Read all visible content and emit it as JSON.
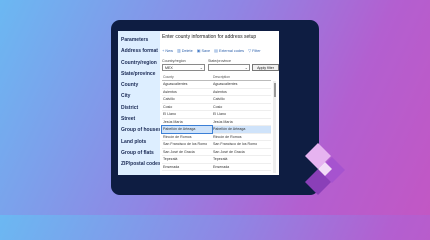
{
  "sidebar": {
    "items": [
      {
        "label": "Parameters"
      },
      {
        "label": "Address format"
      },
      {
        "label": "Country/region"
      },
      {
        "label": "State/province"
      },
      {
        "label": "County"
      },
      {
        "label": "City"
      },
      {
        "label": "District"
      },
      {
        "label": "Street"
      },
      {
        "label": "Group of houses"
      },
      {
        "label": "Land plots"
      },
      {
        "label": "Group of flats"
      },
      {
        "label": "ZIP/postal codes"
      }
    ]
  },
  "main": {
    "title": "Enter county information for address setup",
    "toolbar": {
      "new_label": "New",
      "delete_label": "Delete",
      "save_label": "Save",
      "external_codes_label": "External codes",
      "filter_label": "Filter"
    },
    "filters": {
      "country_label": "Country/region",
      "country_value": "MEX",
      "state_label": "State/province",
      "state_value": "",
      "apply_label": "Apply filter"
    },
    "grid": {
      "columns": [
        "County",
        "Description"
      ],
      "rows": [
        {
          "county": "Aguascalientes",
          "description": "Aguascalientes"
        },
        {
          "county": "Asientos",
          "description": "Asientos"
        },
        {
          "county": "Calvillo",
          "description": "Calvillo"
        },
        {
          "county": "Cosio",
          "description": "Cosio"
        },
        {
          "county": "El Llano",
          "description": "El Llano"
        },
        {
          "county": "Jesús María",
          "description": "Jesús María"
        },
        {
          "county": "Pabellón de Arteaga",
          "description": "Pabellón de Arteaga"
        },
        {
          "county": "Rincón de Romos",
          "description": "Rincón de Romos"
        },
        {
          "county": "San Francisco de los Romo",
          "description": "San Francisco de los Romo"
        },
        {
          "county": "San José de Gracia",
          "description": "San José de Gracia"
        },
        {
          "county": "Tepezalá",
          "description": "Tepezalá"
        },
        {
          "county": "Ensenada",
          "description": "Ensenada"
        }
      ],
      "selected_index": 6
    }
  },
  "colors": {
    "frame": "#0e1d42",
    "sidebar_bg": "#ddeeff",
    "selection": "#cfe3fa",
    "logo_light": "#e6b3f0",
    "logo_dark": "#8a3fb8"
  },
  "icons": [
    "plus-icon",
    "delete-icon",
    "save-icon",
    "external-codes-icon",
    "filter-icon",
    "chevron-down-icon",
    "power-apps-logo"
  ]
}
